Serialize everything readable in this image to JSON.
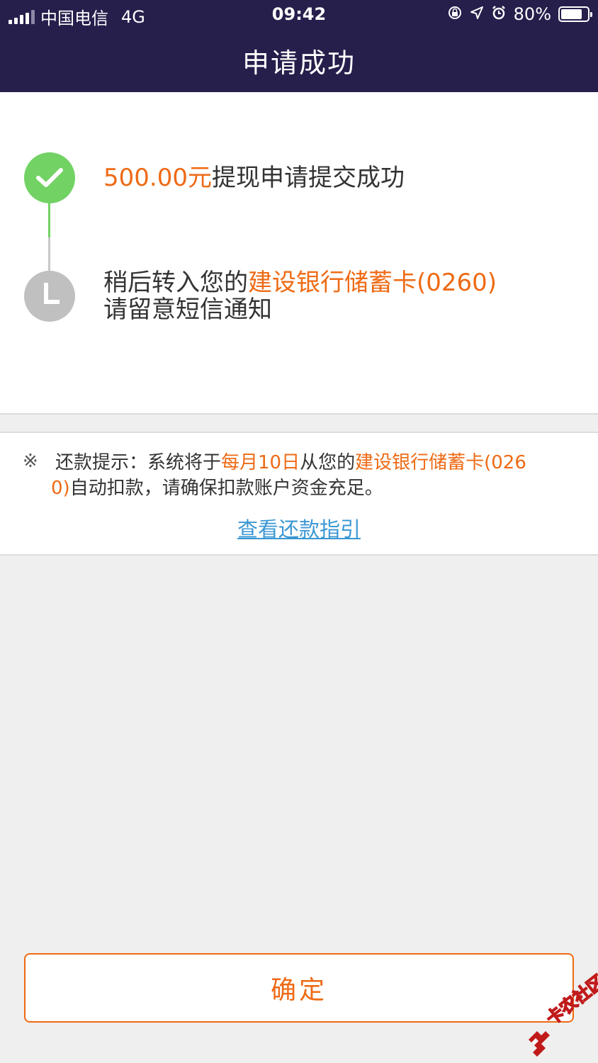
{
  "status_bar": {
    "carrier": "中国电信",
    "network": "4G",
    "time": "09:42",
    "battery": "80%"
  },
  "header": {
    "title": "申请成功"
  },
  "progress": {
    "step1": {
      "amount": "500.00元",
      "text": "提现申请提交成功",
      "status": "done"
    },
    "step2": {
      "prefix": "稍后转入您的",
      "bank": "建设银行储蓄卡(0260)",
      "line2": "请留意短信通知",
      "status": "pending"
    }
  },
  "notice": {
    "mark": "※",
    "part1": "还款提示：系统将于",
    "date": "每月10日",
    "part2": "从您的",
    "bank": "建设银行储蓄卡(026",
    "bank_tail": "0)",
    "part3": "自动扣款，请确保扣款账户资金充足。",
    "guide_link": "查看还款指引"
  },
  "confirm_button": "确定",
  "watermark": "卡农社区",
  "colors": {
    "header_bg": "#261e4b",
    "accent_orange": "#ee6a15",
    "success_green": "#72d264",
    "link_blue": "#3b97d3"
  }
}
